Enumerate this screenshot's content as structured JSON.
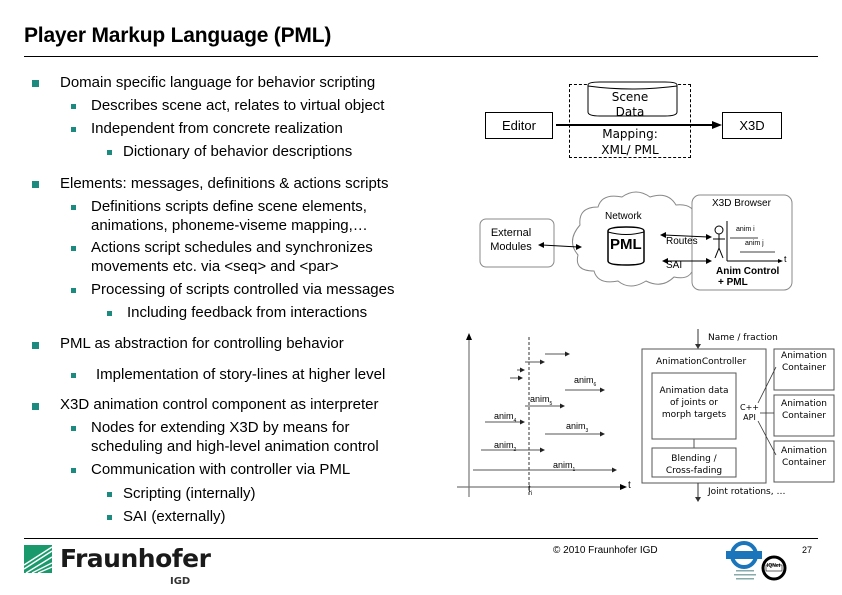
{
  "slide": {
    "title": "Player Markup Language (PML)",
    "page_number": "27",
    "copyright": "© 2010 Fraunhofer IGD",
    "bullet_color": "#1d8a80"
  },
  "bullets": [
    {
      "text": "Domain specific language for behavior scripting",
      "children": [
        {
          "text": "Describes scene act, relates to virtual object"
        },
        {
          "text": "Independent from concrete realization",
          "children": [
            {
              "text": "Dictionary of behavior descriptions"
            }
          ]
        }
      ]
    },
    {
      "text": "Elements: messages, definitions & actions scripts",
      "children": [
        {
          "text_lines": [
            "Definitions scripts define scene elements,",
            "animations, phoneme-viseme mapping,…"
          ]
        },
        {
          "text_lines": [
            "Actions script schedules and synchronizes",
            "movements etc. via <seq> and <par>"
          ]
        },
        {
          "text": "Processing of scripts controlled via messages",
          "children": [
            {
              "text": "Including feedback from interactions"
            }
          ]
        }
      ]
    },
    {
      "text": "PML as abstraction for controlling behavior",
      "children": [
        {
          "text": "Implementation of story-lines at higher level"
        }
      ]
    },
    {
      "text": "X3D animation control component as interpreter",
      "children": [
        {
          "text_lines": [
            "Nodes for extending X3D by means for",
            "scheduling and high-level animation control"
          ]
        },
        {
          "text": "Communication with controller via PML",
          "children": [
            {
              "text": "Scripting (internally)"
            },
            {
              "text": "SAI (externally)"
            }
          ]
        }
      ]
    }
  ],
  "diagram_pipeline": {
    "editor": "Editor",
    "scene_data": [
      "Scene",
      "Data"
    ],
    "mapping": [
      "Mapping:",
      "XML/ PML"
    ],
    "x3d": "X3D"
  },
  "diagram_network": {
    "external_modules": [
      "External",
      "Modules"
    ],
    "network": "Network",
    "pml": "PML",
    "routes": "Routes",
    "sai": "SAI",
    "x3d_browser": "X3D Browser",
    "anim_i": "anim i",
    "anim_j": "anim j",
    "t": "t",
    "anim_control": [
      "Anim Control",
      "+ PML"
    ]
  },
  "diagram_timeline": {
    "anims": [
      "anim1",
      "anim2",
      "anim3",
      "anim4",
      "anim5",
      "anim6"
    ],
    "labels": {
      "anim1": "anim",
      "anim2": "anim",
      "anim3": "anim",
      "anim4": "anim",
      "anim5": "anim",
      "anim6": "anim"
    },
    "subs": {
      "anim1": "1",
      "anim2": "2",
      "anim3": "3",
      "anim4": "4",
      "anim5": "5",
      "anim6": "6"
    },
    "t_axis": "t",
    "t_marker": "t",
    "t_marker_sub": "i"
  },
  "diagram_controller": {
    "input": "Name / fraction",
    "controller": "AnimationController",
    "anim_data": [
      "Animation data",
      "of joints or",
      "morph targets"
    ],
    "blending": [
      "Blending /",
      "Cross-fading"
    ],
    "api": [
      "C++",
      "API"
    ],
    "containers": [
      [
        "Animation",
        "Container"
      ],
      [
        "Animation",
        "Container"
      ],
      [
        "Animation",
        "Container"
      ]
    ],
    "output": "Joint rotations, …"
  },
  "footer": {
    "logo_name": "Fraunhofer",
    "logo_sub": "IGD",
    "cert_text": "DQS",
    "iqnet": "IQNet"
  }
}
